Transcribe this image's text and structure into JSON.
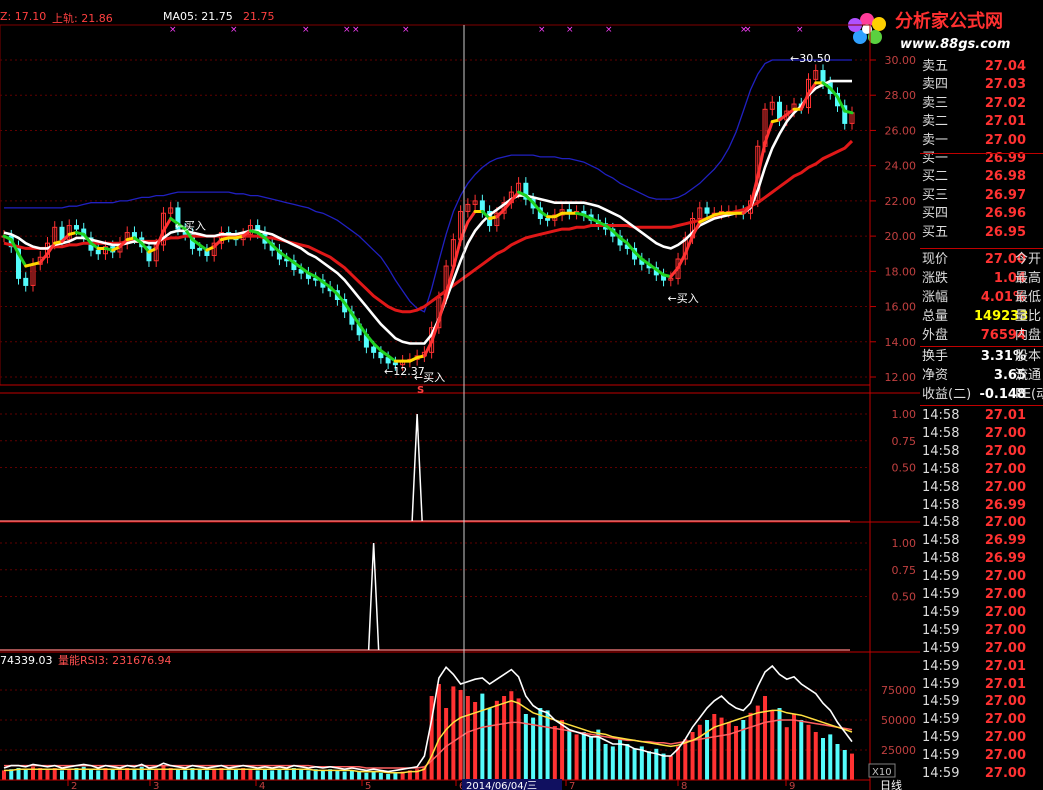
{
  "header": {
    "upper_band_partial": "Z: 17.10",
    "upper_label": "上轨: 21.86",
    "ma_label": "MA05: 21.75",
    "ma_value2": "21.75"
  },
  "logo": {
    "name": "分析家公式网",
    "url": "www.88gs.com"
  },
  "colors": {
    "up": "#ff3232",
    "down": "#54fcfc",
    "ma_white": "#ffffff",
    "ma_red": "#e01818",
    "band_blue": "#2020c0",
    "ema_green": "#20d020",
    "ema_yellow": "#ffd800",
    "grid": "#800000",
    "axis_text": "#c04040",
    "yellow": "#ffff00",
    "magenta": "#ff40ff"
  },
  "price_axis": {
    "ticks": [
      "30.00",
      "28.00",
      "26.00",
      "24.00",
      "22.00",
      "20.00",
      "18.00",
      "16.00",
      "14.00",
      "12.00"
    ]
  },
  "annotations": {
    "low": "12.37",
    "high": "30.50",
    "buy": "买入",
    "marker_s": "S"
  },
  "indicator1": {
    "ticks": [
      "1.00",
      "0.75",
      "0.50"
    ]
  },
  "indicator2": {
    "ticks": [
      "1.00",
      "0.75",
      "0.50"
    ]
  },
  "volume": {
    "header_value": "74339.03",
    "header_label": "量能RSI3: 231676.94",
    "ticks": [
      "75000",
      "50000",
      "25000"
    ],
    "scale": "X10"
  },
  "date_axis": {
    "labels": [
      "2",
      "3",
      "4",
      "5",
      "6",
      "7",
      "8",
      "9"
    ],
    "cursor_date": "2014/06/04/三",
    "period": "日线"
  },
  "order_book": [
    {
      "label": "卖五",
      "price": "27.04"
    },
    {
      "label": "卖四",
      "price": "27.03"
    },
    {
      "label": "卖三",
      "price": "27.02"
    },
    {
      "label": "卖二",
      "price": "27.01"
    },
    {
      "label": "卖一",
      "price": "27.00"
    },
    {
      "label": "买一",
      "price": "26.99"
    },
    {
      "label": "买二",
      "price": "26.98"
    },
    {
      "label": "买三",
      "price": "26.97"
    },
    {
      "label": "买四",
      "price": "26.96"
    },
    {
      "label": "买五",
      "price": "26.95"
    }
  ],
  "quote": [
    {
      "label": "现价",
      "value": "27.00",
      "label2": "今开",
      "color": "#ff3232"
    },
    {
      "label": "涨跌",
      "value": "1.04",
      "label2": "最高",
      "color": "#ff3232"
    },
    {
      "label": "涨幅",
      "value": "4.01%",
      "label2": "最低",
      "color": "#ff3232"
    },
    {
      "label": "总量",
      "value": "149233",
      "label2": "量比",
      "color": "#ffff00"
    },
    {
      "label": "外盘",
      "value": "76594",
      "label2": "内盘",
      "color": "#ff3232"
    }
  ],
  "stats": [
    {
      "label": "换手",
      "value": "3.31%",
      "label2": "股本"
    },
    {
      "label": "净资",
      "value": "3.65",
      "label2": "流通"
    },
    {
      "label": "收益(二)",
      "value": "-0.148",
      "label2": "PE(动"
    }
  ],
  "ticks": [
    {
      "time": "14:58",
      "price": "27.01"
    },
    {
      "time": "14:58",
      "price": "27.00"
    },
    {
      "time": "14:58",
      "price": "27.00"
    },
    {
      "time": "14:58",
      "price": "27.00"
    },
    {
      "time": "14:58",
      "price": "27.00"
    },
    {
      "time": "14:58",
      "price": "26.99"
    },
    {
      "time": "14:58",
      "price": "27.00"
    },
    {
      "time": "14:58",
      "price": "26.99"
    },
    {
      "time": "14:58",
      "price": "26.99"
    },
    {
      "time": "14:59",
      "price": "27.00"
    },
    {
      "time": "14:59",
      "price": "27.00"
    },
    {
      "time": "14:59",
      "price": "27.00"
    },
    {
      "time": "14:59",
      "price": "27.00"
    },
    {
      "time": "14:59",
      "price": "27.00"
    },
    {
      "time": "14:59",
      "price": "27.01"
    },
    {
      "time": "14:59",
      "price": "27.01"
    },
    {
      "time": "14:59",
      "price": "27.00"
    },
    {
      "time": "14:59",
      "price": "27.00"
    },
    {
      "time": "14:59",
      "price": "27.00"
    },
    {
      "time": "14:59",
      "price": "27.00"
    },
    {
      "time": "14:59",
      "price": "27.00"
    }
  ],
  "chart_data": {
    "type": "candlestick",
    "price_ylim": [
      11.5,
      30.5
    ],
    "closes": [
      20.0,
      19.4,
      17.6,
      17.2,
      18.4,
      18.8,
      19.6,
      20.5,
      19.8,
      20.6,
      20.4,
      19.9,
      19.2,
      19.0,
      19.4,
      19.1,
      19.6,
      20.2,
      19.9,
      19.4,
      18.6,
      19.5,
      21.3,
      21.6,
      20.4,
      20.1,
      19.3,
      19.2,
      18.9,
      19.6,
      20.2,
      20.0,
      19.8,
      20.1,
      20.6,
      20.2,
      19.6,
      19.2,
      18.7,
      18.6,
      18.1,
      17.9,
      17.6,
      17.5,
      17.1,
      16.9,
      16.4,
      15.7,
      15.0,
      14.4,
      13.7,
      13.4,
      13.1,
      12.8,
      12.7,
      12.9,
      13.0,
      13.2,
      13.4,
      14.8,
      16.5,
      18.3,
      19.8,
      21.4,
      21.8,
      22.0,
      21.4,
      20.6,
      21.3,
      21.9,
      22.5,
      23.0,
      22.1,
      21.6,
      21.0,
      20.9,
      21.2,
      21.5,
      21.3,
      21.4,
      21.2,
      20.9,
      20.7,
      20.4,
      20.0,
      19.5,
      19.3,
      18.7,
      18.4,
      18.2,
      17.8,
      17.5,
      17.6,
      18.7,
      19.9,
      21.0,
      21.6,
      21.3,
      21.3,
      21.4,
      21.4,
      21.4,
      21.3,
      22.0,
      25.1,
      27.2,
      27.6,
      26.6,
      27.1,
      27.5,
      27.3,
      28.9,
      29.4,
      28.7,
      28.1,
      27.4,
      26.4,
      27.0
    ],
    "ema_fast": [
      20.0,
      19.8,
      19.0,
      18.3,
      18.4,
      18.5,
      19.0,
      19.6,
      19.7,
      20.1,
      20.2,
      20.1,
      19.6,
      19.3,
      19.3,
      19.2,
      19.4,
      19.8,
      19.9,
      19.6,
      19.1,
      19.3,
      20.3,
      21.0,
      20.7,
      20.4,
      19.8,
      19.5,
      19.2,
      19.4,
      19.8,
      19.9,
      19.9,
      20.0,
      20.3,
      20.2,
      19.9,
      19.5,
      19.1,
      18.8,
      18.5,
      18.2,
      17.9,
      17.7,
      17.4,
      17.1,
      16.7,
      16.2,
      15.6,
      15.0,
      14.4,
      13.9,
      13.5,
      13.2,
      12.9,
      12.9,
      12.9,
      13.1,
      13.2,
      14.0,
      15.2,
      16.7,
      18.2,
      19.8,
      20.8,
      21.4,
      21.4,
      21.0,
      21.1,
      21.5,
      22.0,
      22.5,
      22.3,
      21.9,
      21.4,
      21.1,
      21.1,
      21.3,
      21.3,
      21.3,
      21.2,
      21.0,
      20.8,
      20.6,
      20.3,
      19.9,
      19.6,
      19.1,
      18.7,
      18.4,
      18.1,
      17.8,
      17.7,
      18.2,
      19.0,
      20.0,
      20.8,
      21.0,
      21.2,
      21.3,
      21.3,
      21.3,
      21.3,
      21.7,
      23.4,
      25.3,
      26.5,
      26.6,
      26.9,
      27.2,
      27.2,
      28.1,
      28.7,
      28.7,
      28.4,
      27.9,
      27.1,
      27.0
    ],
    "ma_white": [
      20.2,
      20.1,
      19.9,
      19.6,
      19.4,
      19.3,
      19.3,
      19.5,
      19.6,
      19.7,
      19.9,
      19.9,
      19.8,
      19.7,
      19.6,
      19.5,
      19.5,
      19.6,
      19.7,
      19.7,
      19.6,
      19.6,
      19.9,
      20.2,
      20.3,
      20.3,
      20.2,
      20.1,
      20.0,
      20.0,
      20.1,
      20.1,
      20.1,
      20.2,
      20.3,
      20.3,
      20.2,
      20.1,
      19.9,
      19.7,
      19.5,
      19.3,
      19.0,
      18.8,
      18.5,
      18.2,
      17.9,
      17.5,
      17.0,
      16.5,
      16.0,
      15.5,
      15.0,
      14.6,
      14.2,
      14.0,
      13.9,
      13.9,
      13.9,
      14.4,
      15.3,
      16.4,
      17.5,
      18.6,
      19.6,
      20.3,
      20.8,
      21.2,
      21.5,
      21.8,
      22.1,
      22.3,
      22.3,
      22.2,
      22.1,
      22.0,
      21.9,
      21.9,
      21.9,
      21.9,
      21.9,
      21.8,
      21.7,
      21.5,
      21.3,
      21.1,
      20.8,
      20.5,
      20.2,
      19.9,
      19.6,
      19.4,
      19.3,
      19.5,
      19.8,
      20.2,
      20.6,
      20.8,
      21.0,
      21.1,
      21.2,
      21.3,
      21.3,
      21.6,
      22.6,
      23.9,
      25.0,
      25.8,
      26.5,
      27.0,
      27.4,
      28.0,
      28.4,
      28.6,
      28.8,
      28.8,
      28.8,
      28.8
    ],
    "ma_red": [
      19.6,
      19.5,
      19.4,
      19.3,
      19.3,
      19.3,
      19.3,
      19.4,
      19.4,
      19.5,
      19.5,
      19.6,
      19.6,
      19.6,
      19.6,
      19.6,
      19.6,
      19.7,
      19.7,
      19.7,
      19.7,
      19.7,
      19.8,
      19.9,
      19.9,
      20.0,
      20.0,
      20.0,
      20.0,
      20.0,
      20.0,
      20.0,
      20.0,
      20.0,
      20.0,
      20.0,
      19.9,
      19.9,
      19.8,
      19.7,
      19.6,
      19.5,
      19.4,
      19.2,
      19.0,
      18.8,
      18.5,
      18.2,
      17.8,
      17.4,
      17.0,
      16.6,
      16.3,
      16.0,
      15.8,
      15.7,
      15.7,
      15.8,
      16.0,
      16.3,
      16.6,
      16.9,
      17.2,
      17.5,
      17.8,
      18.1,
      18.4,
      18.7,
      19.0,
      19.2,
      19.5,
      19.7,
      19.9,
      20.0,
      20.1,
      20.2,
      20.3,
      20.4,
      20.4,
      20.5,
      20.5,
      20.6,
      20.6,
      20.6,
      20.6,
      20.6,
      20.6,
      20.5,
      20.5,
      20.5,
      20.5,
      20.5,
      20.5,
      20.6,
      20.7,
      20.8,
      20.9,
      21.0,
      21.1,
      21.2,
      21.3,
      21.4,
      21.5,
      21.7,
      21.9,
      22.2,
      22.5,
      22.8,
      23.1,
      23.4,
      23.6,
      23.9,
      24.1,
      24.4,
      24.6,
      24.8,
      25.0,
      25.4
    ],
    "band_upper": [
      21.6,
      21.6,
      21.6,
      21.6,
      21.6,
      21.6,
      21.6,
      21.6,
      21.6,
      21.7,
      21.7,
      21.8,
      21.9,
      21.9,
      21.9,
      21.9,
      22.0,
      22.0,
      22.1,
      22.2,
      22.2,
      22.3,
      22.3,
      22.4,
      22.5,
      22.5,
      22.5,
      22.5,
      22.5,
      22.5,
      22.5,
      22.5,
      22.4,
      22.4,
      22.3,
      22.3,
      22.2,
      22.1,
      22.0,
      21.9,
      21.8,
      21.7,
      21.6,
      21.4,
      21.3,
      21.1,
      20.9,
      20.6,
      20.3,
      20.0,
      19.6,
      19.2,
      18.8,
      18.2,
      17.5,
      16.9,
      16.3,
      15.9,
      15.7,
      17.0,
      18.6,
      20.1,
      21.4,
      22.3,
      23.0,
      23.5,
      23.9,
      24.2,
      24.4,
      24.5,
      24.6,
      24.6,
      24.6,
      24.6,
      24.5,
      24.5,
      24.5,
      24.4,
      24.4,
      24.3,
      24.2,
      24.0,
      23.8,
      23.5,
      23.3,
      23.0,
      22.8,
      22.6,
      22.4,
      22.2,
      22.1,
      22.1,
      22.1,
      22.2,
      22.4,
      22.7,
      23.0,
      23.4,
      23.8,
      24.3,
      25.0,
      25.9,
      27.1,
      28.3,
      29.2,
      29.8,
      30.0,
      30.0,
      30.0,
      30.0,
      30.0,
      30.0,
      30.0,
      30.0,
      30.0,
      30.0,
      30.0,
      30.0
    ],
    "buy_signals_index": [
      23,
      56,
      91
    ],
    "indicator1_signal_index": 57,
    "indicator2_signal_index": 51,
    "volume_ylim": [
      0,
      100000
    ],
    "volume_x10": [
      8,
      9,
      10,
      9,
      11,
      10,
      9,
      10,
      8,
      9,
      10,
      11,
      9,
      8,
      10,
      9,
      8,
      10,
      9,
      11,
      8,
      9,
      12,
      10,
      9,
      8,
      10,
      9,
      8,
      9,
      10,
      8,
      9,
      10,
      9,
      8,
      9,
      8,
      9,
      8,
      10,
      9,
      8,
      9,
      8,
      9,
      8,
      7,
      8,
      7,
      6,
      7,
      6,
      5,
      6,
      7,
      8,
      9,
      11,
      70,
      80,
      60,
      78,
      75,
      70,
      65,
      72,
      60,
      66,
      70,
      74,
      68,
      55,
      52,
      60,
      58,
      45,
      50,
      42,
      38,
      40,
      36,
      42,
      30,
      28,
      34,
      30,
      26,
      28,
      24,
      26,
      22,
      20,
      28,
      34,
      40,
      46,
      50,
      55,
      52,
      48,
      45,
      50,
      56,
      62,
      70,
      58,
      60,
      44,
      55,
      50,
      46,
      40,
      35,
      38,
      30,
      25,
      22
    ],
    "volume_lines": {
      "white": [
        10,
        12,
        12,
        11,
        13,
        12,
        11,
        12,
        10,
        11,
        12,
        13,
        12,
        10,
        12,
        11,
        10,
        12,
        11,
        13,
        10,
        11,
        14,
        12,
        11,
        10,
        12,
        11,
        10,
        11,
        12,
        10,
        11,
        12,
        11,
        10,
        11,
        10,
        11,
        10,
        12,
        11,
        10,
        11,
        10,
        11,
        10,
        9,
        10,
        9,
        8,
        9,
        8,
        7,
        8,
        9,
        10,
        11,
        20,
        50,
        85,
        94,
        88,
        80,
        82,
        84,
        85,
        80,
        84,
        88,
        92,
        86,
        70,
        62,
        58,
        56,
        50,
        46,
        42,
        40,
        38,
        36,
        36,
        33,
        30,
        30,
        29,
        26,
        25,
        23,
        22,
        20,
        20,
        26,
        34,
        44,
        52,
        60,
        66,
        70,
        64,
        60,
        58,
        64,
        78,
        90,
        95,
        88,
        84,
        86,
        80,
        76,
        72,
        64,
        58,
        48,
        40,
        32
      ],
      "yellow": [
        8,
        8,
        9,
        9,
        9,
        9,
        9,
        9,
        9,
        9,
        9,
        9,
        9,
        9,
        9,
        9,
        9,
        9,
        9,
        9,
        9,
        9,
        9,
        9,
        9,
        9,
        9,
        9,
        9,
        9,
        9,
        9,
        9,
        9,
        9,
        9,
        9,
        9,
        9,
        9,
        9,
        9,
        9,
        8,
        8,
        8,
        8,
        8,
        8,
        7,
        7,
        7,
        7,
        6,
        6,
        6,
        7,
        7,
        9,
        20,
        34,
        42,
        48,
        52,
        54,
        56,
        58,
        60,
        62,
        64,
        66,
        64,
        60,
        56,
        54,
        52,
        50,
        48,
        46,
        44,
        42,
        40,
        39,
        38,
        36,
        35,
        34,
        33,
        32,
        31,
        30,
        29,
        28,
        29,
        31,
        33,
        36,
        40,
        44,
        46,
        48,
        50,
        52,
        54,
        56,
        57,
        58,
        58,
        56,
        55,
        54,
        52,
        50,
        48,
        46,
        44,
        42,
        40
      ],
      "red": [
        12,
        12,
        12,
        12,
        12,
        12,
        12,
        12,
        12,
        12,
        12,
        12,
        12,
        12,
        12,
        12,
        12,
        12,
        12,
        12,
        12,
        12,
        12,
        12,
        12,
        12,
        12,
        12,
        12,
        12,
        12,
        12,
        12,
        12,
        12,
        12,
        12,
        12,
        12,
        12,
        12,
        12,
        12,
        11,
        11,
        11,
        11,
        11,
        11,
        11,
        10,
        10,
        10,
        10,
        10,
        10,
        10,
        10,
        11,
        16,
        22,
        28,
        32,
        36,
        40,
        42,
        44,
        45,
        46,
        47,
        48,
        48,
        47,
        46,
        45,
        44,
        43,
        42,
        41,
        40,
        39,
        38,
        37,
        36,
        35,
        34,
        33,
        33,
        32,
        32,
        31,
        31,
        30,
        31,
        32,
        33,
        34,
        35,
        36,
        37,
        38,
        40,
        42,
        44,
        46,
        48,
        49,
        50,
        50,
        50,
        49,
        48,
        47,
        46,
        45,
        44,
        43,
        42
      ]
    }
  }
}
